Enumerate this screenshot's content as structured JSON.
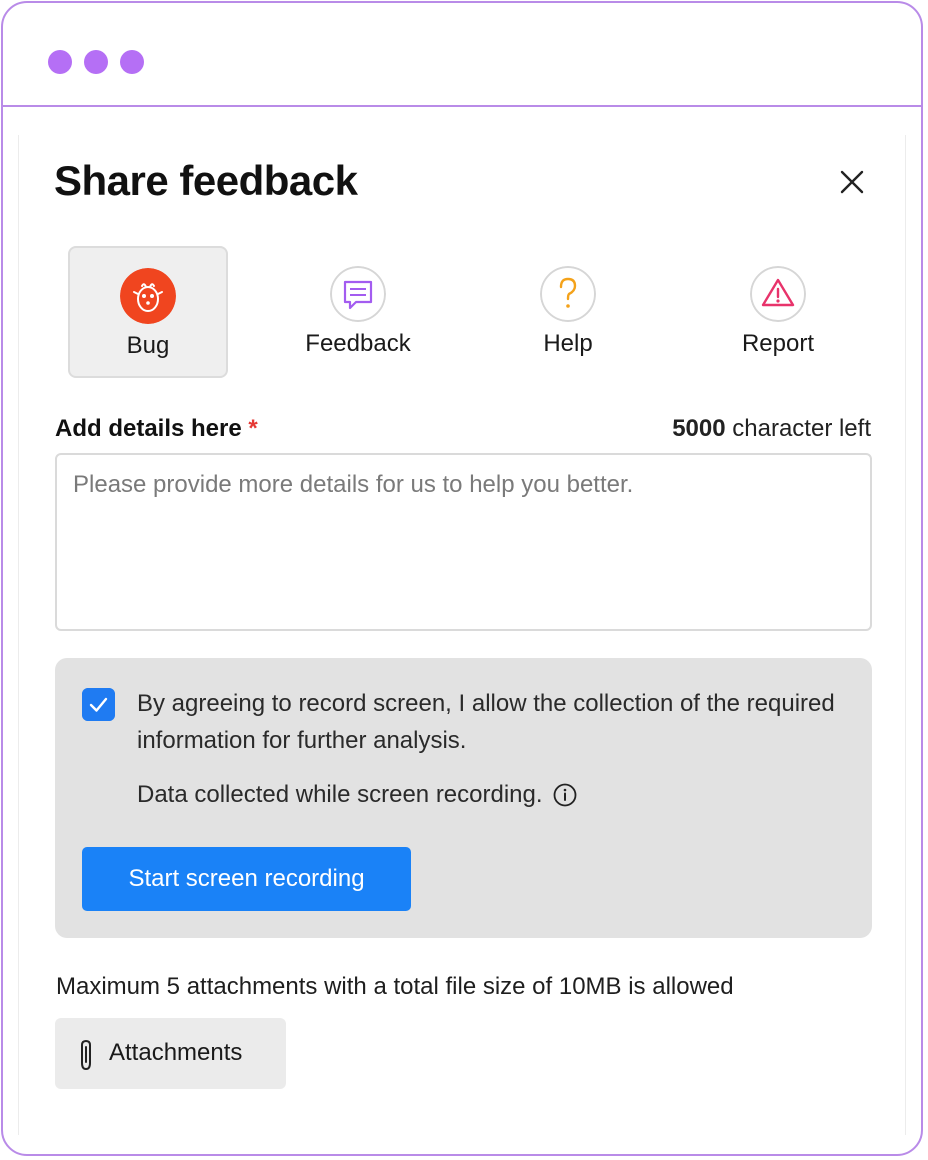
{
  "window": {
    "controls": [
      "dot",
      "dot",
      "dot"
    ],
    "border_color": "#b98be8",
    "dot_color": "#b56ff5"
  },
  "dialog": {
    "title": "Share feedback",
    "close_icon": "close-icon"
  },
  "types": [
    {
      "label": "Bug",
      "icon": "bug-icon",
      "selected": true,
      "color": "#f0451f"
    },
    {
      "label": "Feedback",
      "icon": "message-icon",
      "selected": false,
      "color": "#a35cf0"
    },
    {
      "label": "Help",
      "icon": "question-icon",
      "selected": false,
      "color": "#f4a21a"
    },
    {
      "label": "Report",
      "icon": "warning-icon",
      "selected": false,
      "color": "#e8336b"
    }
  ],
  "details": {
    "label": "Add details here",
    "required_mark": "*",
    "count": "5000",
    "count_suffix": "character left",
    "placeholder": "Please provide more details for us to help you better.",
    "value": ""
  },
  "consent": {
    "checked": true,
    "text": "By agreeing to record screen, I allow the collection of the required information for further analysis.",
    "data_note": "Data collected while screen recording.",
    "record_button": "Start screen recording",
    "accent": "#1a82f7"
  },
  "attachments": {
    "limit_text": "Maximum 5 attachments with a total file size of 10MB is allowed",
    "button_label": "Attachments",
    "icon": "paperclip-icon"
  }
}
